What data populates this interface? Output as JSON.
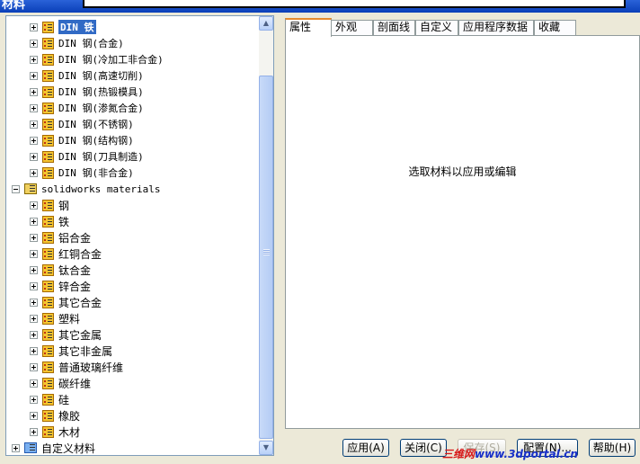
{
  "window": {
    "title": "材料"
  },
  "tree": {
    "din_items": [
      {
        "label": "DIN 铁",
        "selected": true
      },
      {
        "label": "DIN 钢(合金)"
      },
      {
        "label": "DIN 钢(冷加工非合金)"
      },
      {
        "label": "DIN 钢(高速切削)"
      },
      {
        "label": "DIN 钢(热锻模具)"
      },
      {
        "label": "DIN 钢(渗氮合金)"
      },
      {
        "label": "DIN 钢(不锈钢)"
      },
      {
        "label": "DIN 钢(结构钢)"
      },
      {
        "label": "DIN 钢(刀具制造)"
      },
      {
        "label": "DIN 钢(非合金)"
      }
    ],
    "solidworks_library": {
      "label": "solidworks materials"
    },
    "sw_items": [
      {
        "label": "钢"
      },
      {
        "label": "铁"
      },
      {
        "label": "铝合金"
      },
      {
        "label": "红铜合金"
      },
      {
        "label": "钛合金"
      },
      {
        "label": "锌合金"
      },
      {
        "label": "其它合金"
      },
      {
        "label": "塑料"
      },
      {
        "label": "其它金属"
      },
      {
        "label": "其它非金属"
      },
      {
        "label": "普通玻璃纤维"
      },
      {
        "label": "碳纤维"
      },
      {
        "label": "硅"
      },
      {
        "label": "橡胶"
      },
      {
        "label": "木材"
      }
    ],
    "custom_library": {
      "label": "自定义材料"
    }
  },
  "tabs": [
    {
      "label": "属性",
      "active": true
    },
    {
      "label": "外观"
    },
    {
      "label": "剖面线"
    },
    {
      "label": "自定义"
    },
    {
      "label": "应用程序数据"
    },
    {
      "label": "收藏"
    }
  ],
  "panel": {
    "message": "选取材料以应用或编辑"
  },
  "buttons": {
    "apply": "应用(A)",
    "close": "关闭(C)",
    "save": "保存(S)",
    "config": "配置(N)...",
    "help": "帮助(H)"
  },
  "watermark": {
    "site": "三维网",
    "url": "www.3dportal.cn"
  },
  "colors": {
    "selection": "#316ac5",
    "active_tab_accent": "#e68b2c",
    "window_bg": "#ece9d8"
  }
}
